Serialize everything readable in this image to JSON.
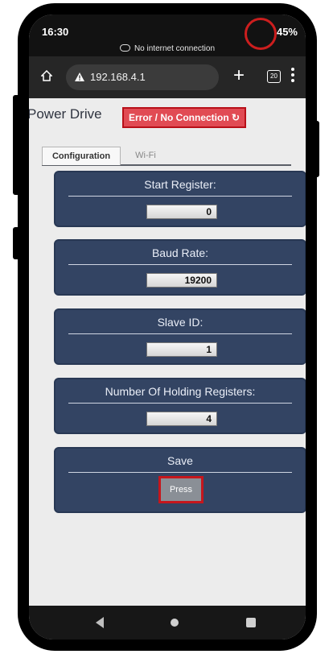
{
  "status_bar": {
    "time": "16:30",
    "battery": "45%",
    "network_message": "No internet connection"
  },
  "browser": {
    "url": "192.168.4.1",
    "tab_count": "20",
    "icons": [
      "home-icon",
      "warning-icon",
      "plus-icon",
      "tabs-icon",
      "menu-icon"
    ]
  },
  "app": {
    "title": "Power Drive",
    "status_badge": "Error / No Connection ↻",
    "tabs": [
      {
        "label": "Configuration",
        "active": true
      },
      {
        "label": "Wi-Fi",
        "active": false
      }
    ],
    "fields": [
      {
        "label": "Start Register:",
        "value": "0"
      },
      {
        "label": "Baud Rate:",
        "value": "19200"
      },
      {
        "label": "Slave ID:",
        "value": "1"
      },
      {
        "label": "Number Of Holding Registers:",
        "value": "4"
      }
    ],
    "save": {
      "label": "Save",
      "button": "Press"
    }
  },
  "colors": {
    "card_bg": "#334463",
    "error_badge": "#e14b54",
    "highlight_outline": "#c5161c"
  }
}
